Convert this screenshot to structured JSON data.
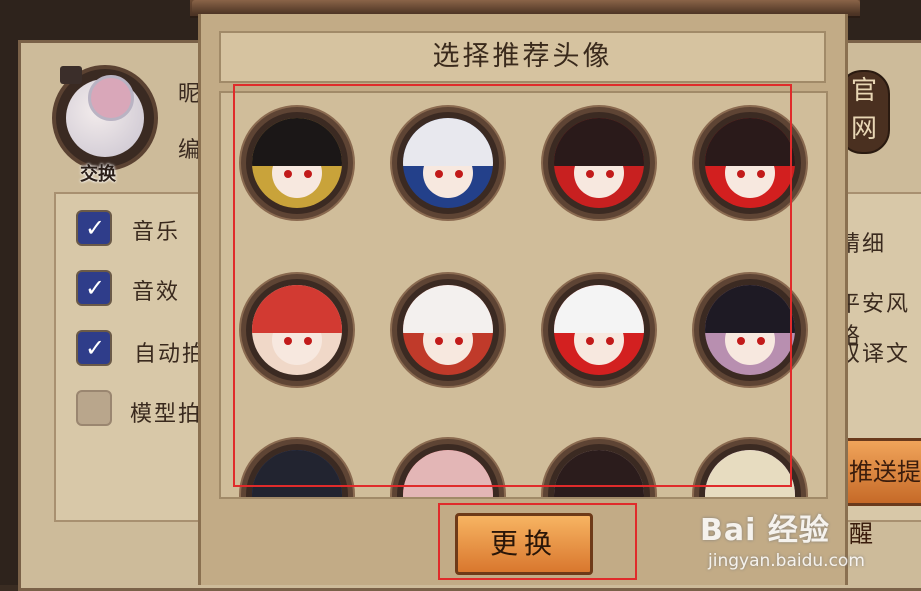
{
  "dialog": {
    "title": "选择推荐头像",
    "confirm_label": "更换"
  },
  "profile": {
    "swap_label": "交换",
    "name_partial": "昵",
    "edit_partial": "编"
  },
  "settings": {
    "options": [
      {
        "label": "音乐",
        "checked": true
      },
      {
        "label": "音效",
        "checked": true
      },
      {
        "label": "自动拍",
        "checked": true
      },
      {
        "label": "模型拍",
        "checked": false
      }
    ],
    "right_options": [
      "精细",
      "平安风格",
      "双译文"
    ],
    "right_button_partial": "推送提醒",
    "right_badge_partial": "官网"
  },
  "avatars": [
    {
      "name": "samurai-helmet",
      "hair": "#1b1717",
      "accent": "#c9a33a"
    },
    {
      "name": "white-hair-blue-hat",
      "hair": "#e8e8ee",
      "accent": "#23408a"
    },
    {
      "name": "dark-bob-red-eyes",
      "hair": "#2a1a1a",
      "accent": "#c82020"
    },
    {
      "name": "red-black-hair",
      "hair": "#2a1a1a",
      "accent": "#d21f1f"
    },
    {
      "name": "red-curly-cat",
      "hair": "#d23a32",
      "accent": "#f0d8c8"
    },
    {
      "name": "white-fox-armor",
      "hair": "#f3f0ee",
      "accent": "#c03a2a"
    },
    {
      "name": "white-hair-crown",
      "hair": "#f4f4f4",
      "accent": "#d32020"
    },
    {
      "name": "black-cat-ears",
      "hair": "#1e1a24",
      "accent": "#b88fb0"
    },
    {
      "name": "crow-tengu",
      "hair": "#222430",
      "accent": "#3a5ca8"
    },
    {
      "name": "pink-fan-girl",
      "hair": "#e3b6b6",
      "accent": "#c82030"
    },
    {
      "name": "dark-hair-mask",
      "hair": "#2b1c1c",
      "accent": "#d7b8b0"
    },
    {
      "name": "blonde-cat-ears",
      "hair": "#e7dcc0",
      "accent": "#a86ec8"
    }
  ],
  "watermark": {
    "brand": "Bai 经验",
    "url": "jingyan.baidu.com"
  }
}
